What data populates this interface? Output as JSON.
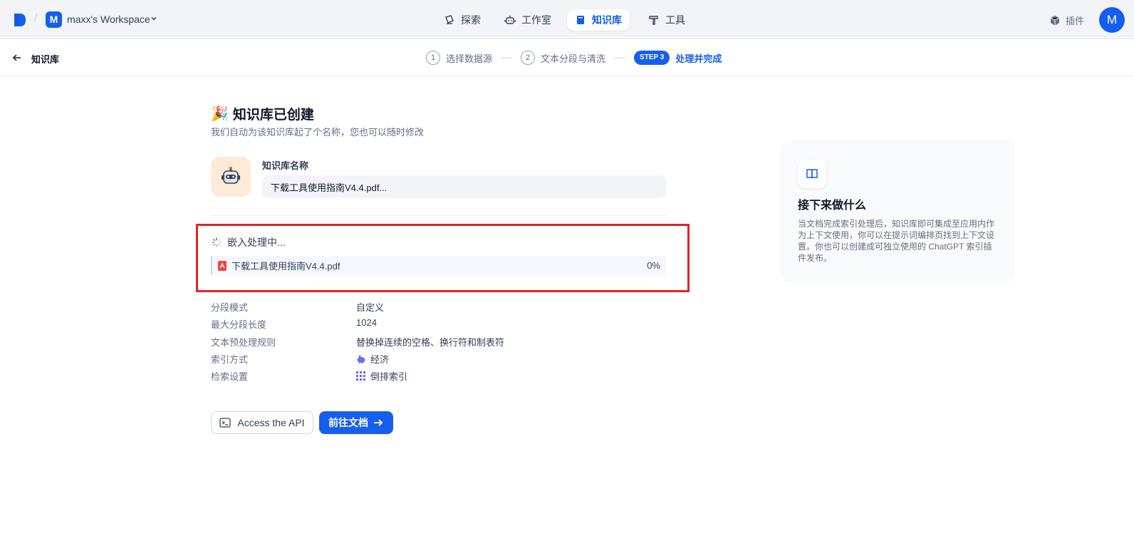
{
  "topbar": {
    "workspace_initial": "M",
    "workspace_name": "maxx's Workspace",
    "nav": [
      {
        "label": "探索",
        "icon": "compass-icon"
      },
      {
        "label": "工作室",
        "icon": "robot-icon"
      },
      {
        "label": "知识库",
        "icon": "book-icon",
        "active": true
      },
      {
        "label": "工具",
        "icon": "hammer-icon"
      }
    ],
    "plugin_label": "插件",
    "user_initial": "M"
  },
  "subbar": {
    "back_label": "知识库",
    "steps": [
      {
        "num": "1",
        "label": "选择数据源"
      },
      {
        "num": "2",
        "label": "文本分段与清洗"
      },
      {
        "badge": "STEP 3",
        "label": "处理并完成",
        "active": true
      }
    ]
  },
  "main": {
    "title": "知识库已创建",
    "subtitle": "我们自动为该知识库起了个名称，您也可以随时修改",
    "name_label": "知识库名称",
    "name_value": "下载工具使用指南V4.4.pdf...",
    "embed_status": "嵌入处理中...",
    "file_name": "下载工具使用指南V4.4.pdf",
    "file_progress": "0%",
    "info": [
      {
        "label": "分段模式",
        "value": "自定义"
      },
      {
        "label": "最大分段长度",
        "value": "1024"
      },
      {
        "label": "文本预处理规则",
        "value": "替换掉连续的空格、换行符和制表符"
      },
      {
        "label": "索引方式",
        "value": "经济",
        "icon": "piggy-bank-icon"
      },
      {
        "label": "检索设置",
        "value": "倒排索引",
        "icon": "grid-icon"
      }
    ],
    "api_button": "Access the API",
    "go_button": "前往文档"
  },
  "side_card": {
    "title": "接下来做什么",
    "text": "当文档完成索引处理后，知识库即可集成至应用内作为上下文使用，你可以在提示词编排页找到上下文设置。你也可以创建成可独立使用的 ChatGPT 索引插件发布。"
  },
  "colors": {
    "primary": "#155eef",
    "highlight_border": "#e02424"
  }
}
